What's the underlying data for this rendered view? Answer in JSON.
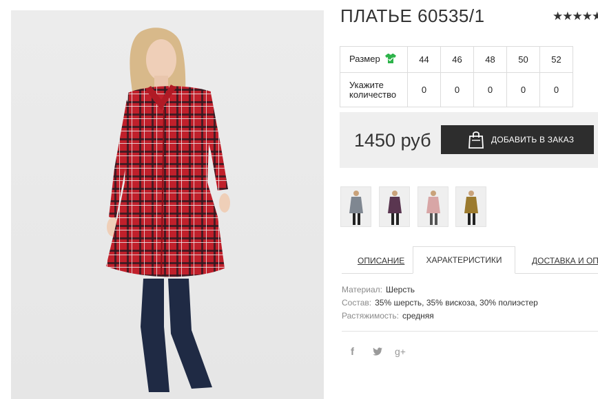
{
  "product": {
    "title": "ПЛАТЬЕ 60535/1",
    "rating_stars": "★★★★★"
  },
  "sizes": {
    "row_label": "Размер",
    "qty_label_1": "Укажите",
    "qty_label_2": "количество",
    "items": [
      {
        "size": "44",
        "qty": "0"
      },
      {
        "size": "46",
        "qty": "0"
      },
      {
        "size": "48",
        "qty": "0"
      },
      {
        "size": "50",
        "qty": "0"
      },
      {
        "size": "52",
        "qty": "0"
      }
    ]
  },
  "order": {
    "price": "1450 руб",
    "add_button": "ДОБАВИТЬ В ЗАКАЗ"
  },
  "tabs": [
    {
      "label": "ОПИСАНИЕ"
    },
    {
      "label": "ХАРАКТЕРИСТИКИ"
    },
    {
      "label": "ДОСТАВКА И ОПЛАТА"
    }
  ],
  "characteristics": [
    {
      "key": "Материал:",
      "value": "Шерсть"
    },
    {
      "key": "Состав:",
      "value": "35% шерсть, 35% вискоза, 30% полиэстер"
    },
    {
      "key": "Растяжимость:",
      "value": "средняя"
    }
  ],
  "social": {
    "facebook": "f",
    "googleplus": "g+"
  },
  "icons": {
    "size_guide": "shirt-icon",
    "bag": "bag-icon",
    "twitter": "twitter-icon"
  },
  "colors": {
    "size_icon": "#2db34a",
    "button_bg": "#2d2d2d",
    "price_box_bg": "#efefef",
    "dress_red": "#c0202b",
    "boots": "#1f2a44"
  }
}
